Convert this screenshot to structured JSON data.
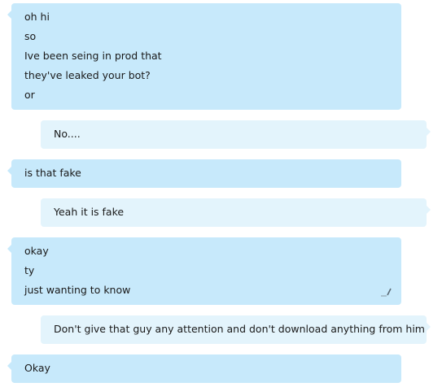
{
  "messages": [
    {
      "side": "in",
      "lines": [
        "oh hi",
        "so",
        "Ive been seing in prod that",
        "they've leaked your bot?",
        "or"
      ]
    },
    {
      "side": "out",
      "lines": [
        "No...."
      ]
    },
    {
      "side": "in",
      "lines": [
        "is that fake"
      ]
    },
    {
      "side": "out",
      "lines": [
        "Yeah it is fake"
      ]
    },
    {
      "side": "in",
      "lines": [
        "okay",
        "ty",
        "just wanting to know"
      ]
    },
    {
      "side": "out",
      "lines": [
        "Don't give that guy any attention and don't download anything from him"
      ]
    },
    {
      "side": "in",
      "lines": [
        "Okay"
      ]
    }
  ],
  "icons": {
    "edit": "pencil-edit-icon"
  },
  "colors": {
    "incoming_bubble": "#c7e9fb",
    "outgoing_bubble": "#e3f4fc",
    "text": "#1a1a1a"
  }
}
